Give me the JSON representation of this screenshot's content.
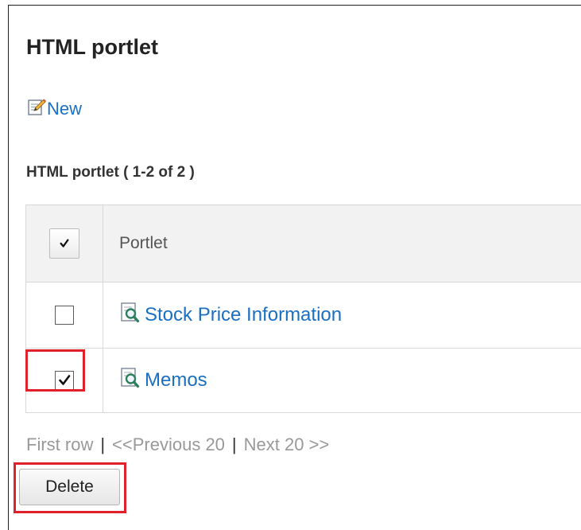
{
  "page": {
    "title": "HTML portlet"
  },
  "actions": {
    "new_label": "New",
    "new_icon": "edit-new-icon"
  },
  "list": {
    "heading": "HTML portlet ( 1-2 of 2 )",
    "columns": {
      "check_all_checked": true,
      "portlet_header": "Portlet"
    },
    "rows": [
      {
        "name": "Stock Price Information",
        "checked": false,
        "icon": "view-magnifier-icon"
      },
      {
        "name": "Memos",
        "checked": true,
        "icon": "view-magnifier-icon"
      }
    ]
  },
  "pager": {
    "first": "First row",
    "previous": "<<Previous 20",
    "next": "Next 20 >>",
    "separator": "|"
  },
  "footer": {
    "delete_label": "Delete"
  },
  "colors": {
    "link": "#1a6fc2",
    "highlight": "#e0202a",
    "header_bg": "#f2f2f2",
    "pager_disabled": "#999999"
  }
}
